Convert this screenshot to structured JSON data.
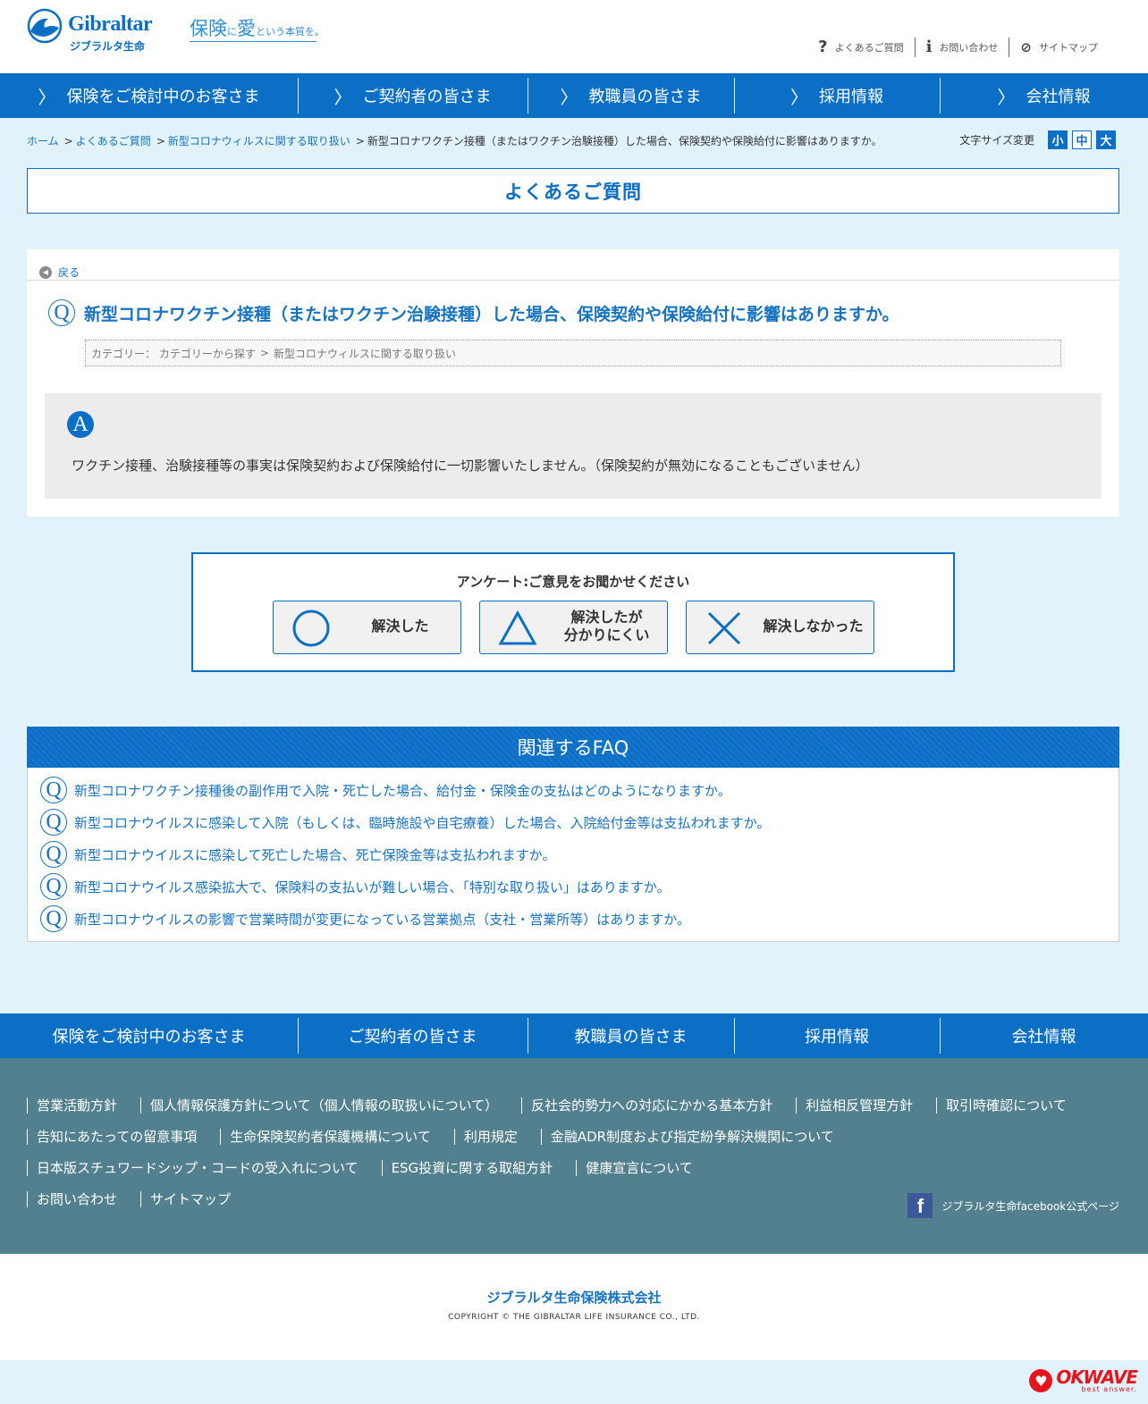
{
  "brand": {
    "name": "Gibraltar",
    "sub": "ジブラルタ生命",
    "tagline_main1": "保険",
    "tagline_small1": "に",
    "tagline_main2": "愛",
    "tagline_small2": "という本質を。"
  },
  "util_links": [
    {
      "label": "よくあるご質問",
      "icon": "question-icon"
    },
    {
      "label": "お問い合わせ",
      "icon": "info-icon"
    },
    {
      "label": "サイトマップ",
      "icon": "compass-icon"
    }
  ],
  "nav": [
    {
      "label": "保険をご検討中のお客さま"
    },
    {
      "label": "ご契約者の皆さま"
    },
    {
      "label": "教職員の皆さま"
    },
    {
      "label": "採用情報"
    },
    {
      "label": "会社情報"
    }
  ],
  "breadcrumb": {
    "home": "ホーム",
    "faq": "よくあるご質問",
    "category": "新型コロナウィルスに関する取り扱い",
    "current": "新型コロナワクチン接種（またはワクチン治験接種）した場合、保険契約や保険給付に影響はありますか。",
    "separator": ">"
  },
  "font_size": {
    "label": "文字サイズ変更",
    "small": "小",
    "medium": "中",
    "large": "大"
  },
  "page_title": "よくあるご質問",
  "faq": {
    "back_label": "戻る",
    "q_mark": "Q",
    "question": "新型コロナワクチン接種（またはワクチン治験接種）した場合、保険契約や保険給付に影響はありますか。",
    "category_label": "カテゴリー：",
    "category_root": "カテゴリーから探す",
    "category_sep": ">",
    "category_name": "新型コロナウィルスに関する取り扱い",
    "a_mark": "A",
    "answer": "ワクチン接種、治験接種等の事実は保険契約および保険給付に一切影響いたしません。（保険契約が無効になることもございません）"
  },
  "survey": {
    "title": "アンケート:ご意見をお聞かせください",
    "buttons": [
      {
        "label": "解決した",
        "symbol": "circle-icon"
      },
      {
        "label1": "解決したが",
        "label2": "分かりにくい",
        "symbol": "triangle-icon"
      },
      {
        "label": "解決しなかった",
        "symbol": "cross-icon"
      }
    ]
  },
  "related": {
    "title": "関連するFAQ",
    "items": [
      "新型コロナワクチン接種後の副作用で入院・死亡した場合、給付金・保険金の支払はどのようになりますか。",
      "新型コロナウイルスに感染して入院（もしくは、臨時施設や自宅療養）した場合、入院給付金等は支払われますか。",
      "新型コロナウイルスに感染して死亡した場合、死亡保険金等は支払われますか。",
      "新型コロナウイルス感染拡大で、保険料の支払いが難しい場合、「特別な取り扱い」はありますか。",
      "新型コロナウイルスの影響で営業時間が変更になっている営業拠点（支社・営業所等）はありますか。"
    ]
  },
  "footer_nav": [
    {
      "label": "保険をご検討中のお客さま"
    },
    {
      "label": "ご契約者の皆さま"
    },
    {
      "label": "教職員の皆さま"
    },
    {
      "label": "採用情報"
    },
    {
      "label": "会社情報"
    }
  ],
  "footer_links": [
    [
      "営業活動方針",
      "個人情報保護方針について（個人情報の取扱いについて）",
      "反社会的勢力への対応にかかる基本方針",
      "利益相反管理方針",
      "取引時確認について"
    ],
    [
      "告知にあたっての留意事項",
      "生命保険契約者保護機構について",
      "利用規定",
      "金融ADR制度および指定紛争解決機関について"
    ],
    [
      "日本版スチュワードシップ・コードの受入れについて",
      "ESG投資に関する取組方針",
      "健康宣言について"
    ],
    [
      "お問い合わせ",
      "サイトマップ"
    ]
  ],
  "facebook": {
    "icon": "f",
    "label": "ジブラルタ生命facebook公式ページ"
  },
  "copyright": {
    "company": "ジブラルタ生命保険株式会社",
    "line": "COPYRIGHT © THE GIBRALTAR LIFE INSURANCE CO., LTD."
  },
  "okwave": {
    "name": "OKWAVE",
    "sub": "best answer."
  },
  "colors": {
    "primary": "#0b6fc6",
    "link": "#1773c2",
    "background": "#e1f2fb",
    "footer": "#52808f"
  }
}
